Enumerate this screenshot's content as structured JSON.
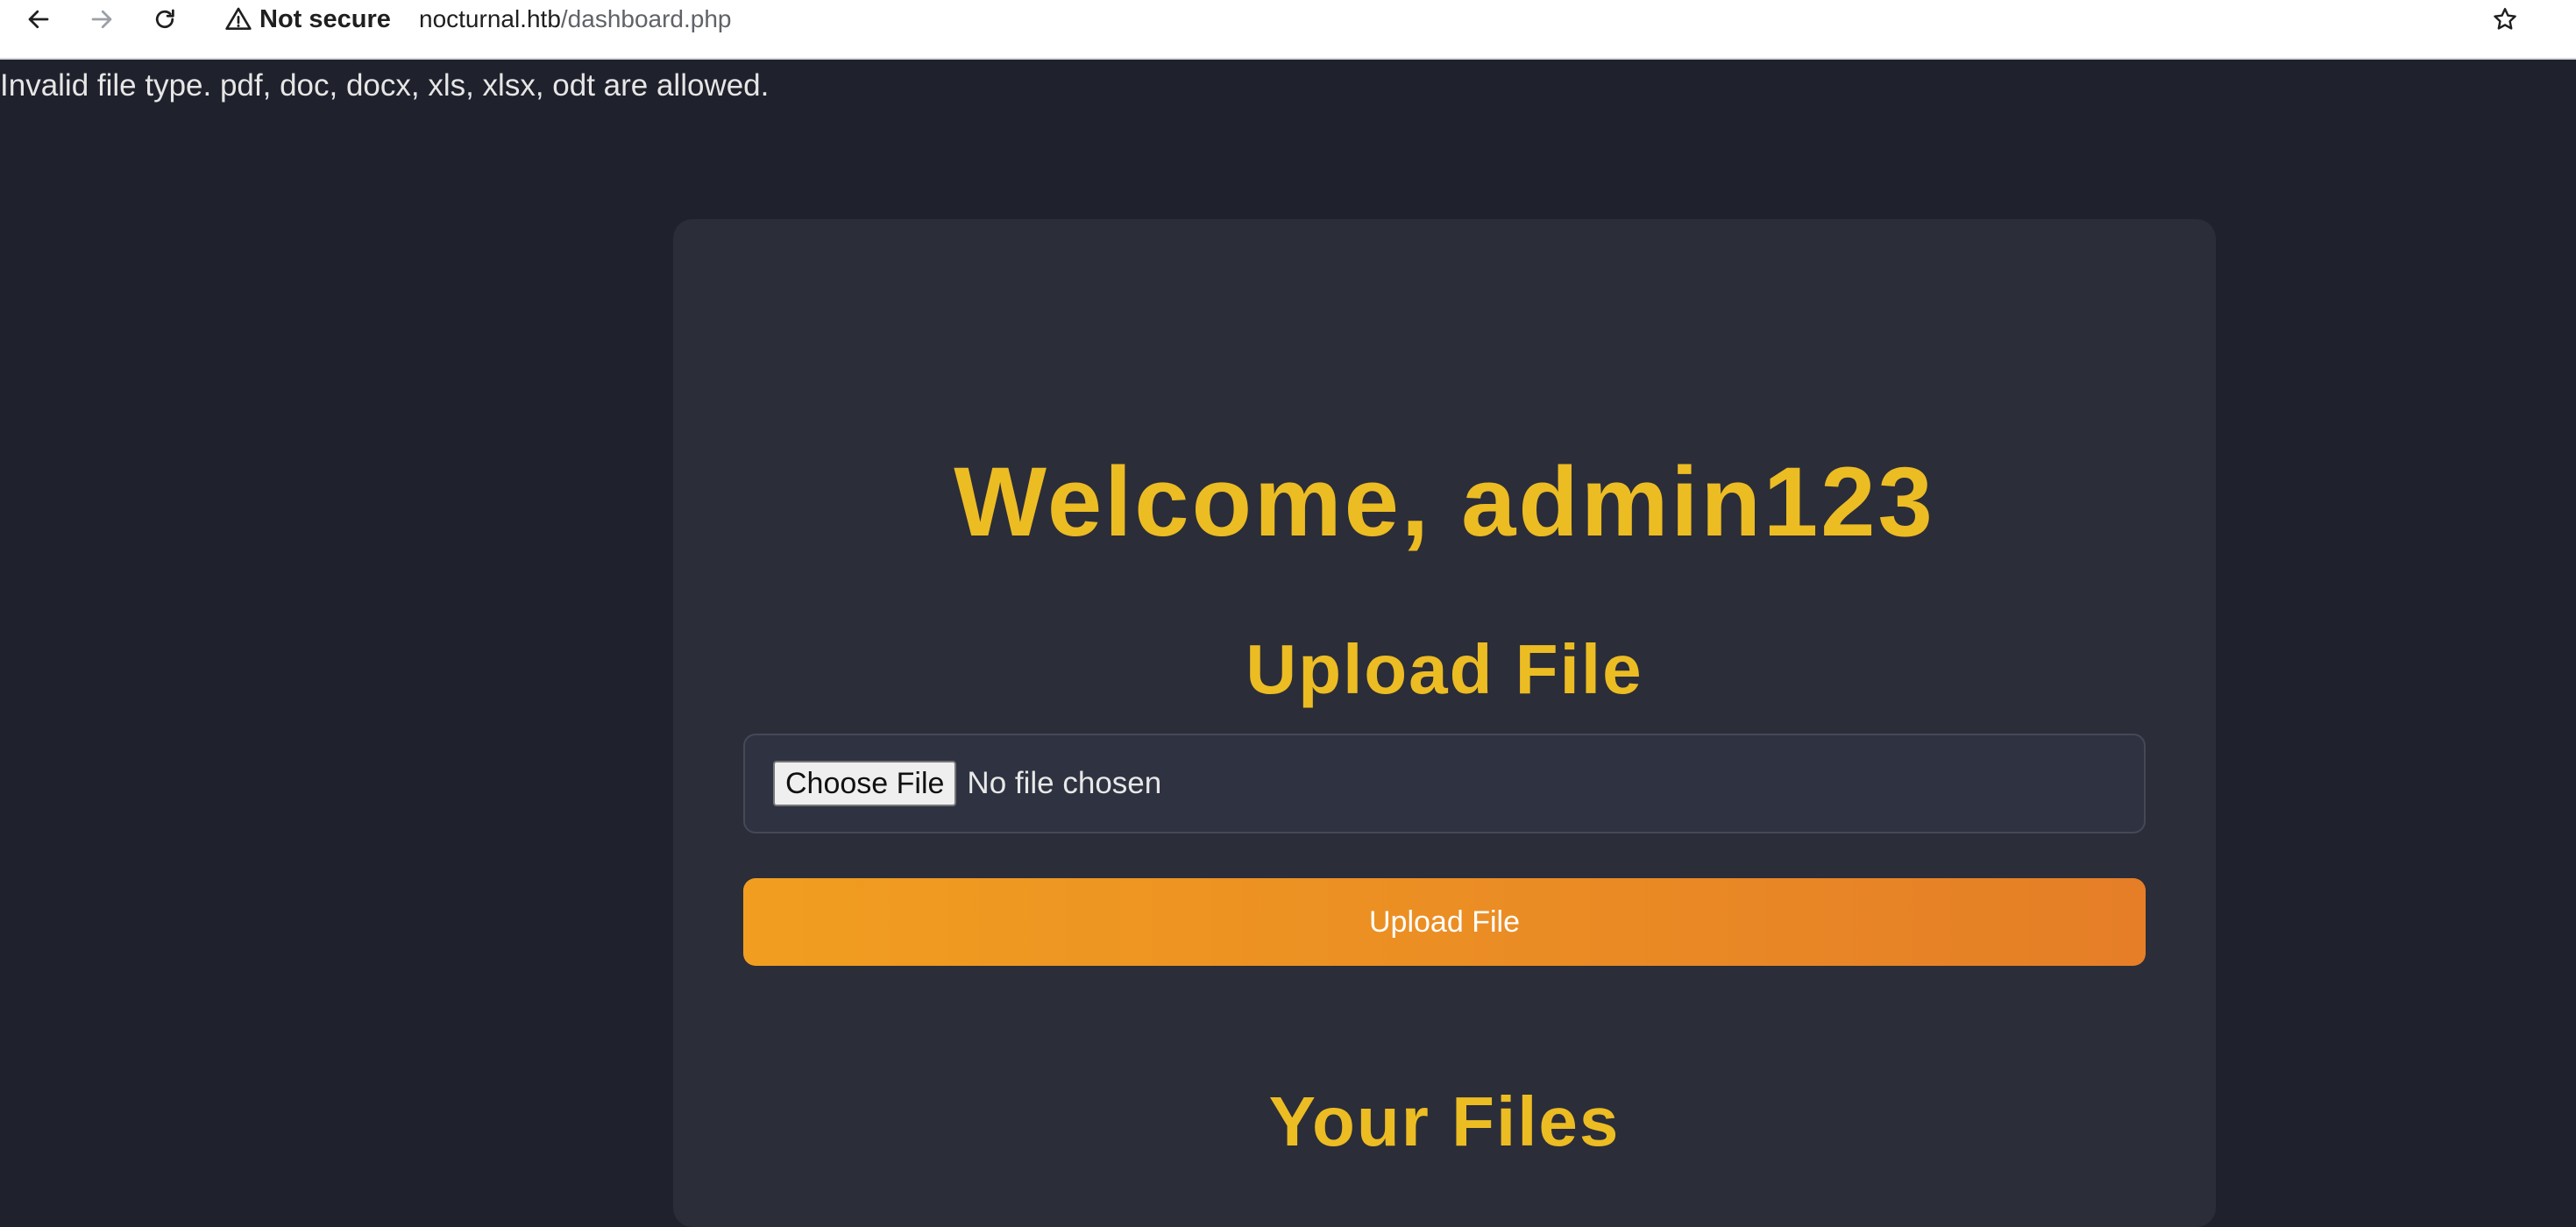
{
  "browser": {
    "security_label": "Not secure",
    "url_domain": "nocturnal.htb",
    "url_path": "/dashboard.php"
  },
  "page": {
    "error_message": "Invalid file type. pdf, doc, docx, xls, xlsx, odt are allowed.",
    "welcome_heading": "Welcome, admin123",
    "upload_section": {
      "heading": "Upload File",
      "choose_file_label": "Choose File",
      "no_file_text": "No file chosen",
      "submit_label": "Upload File"
    },
    "files_section": {
      "heading": "Your Files"
    }
  },
  "colors": {
    "background": "#1f222c",
    "card": "#2b2d39",
    "accent": "#ecbc23",
    "button_start": "#f19e20",
    "button_end": "#e57e27"
  }
}
